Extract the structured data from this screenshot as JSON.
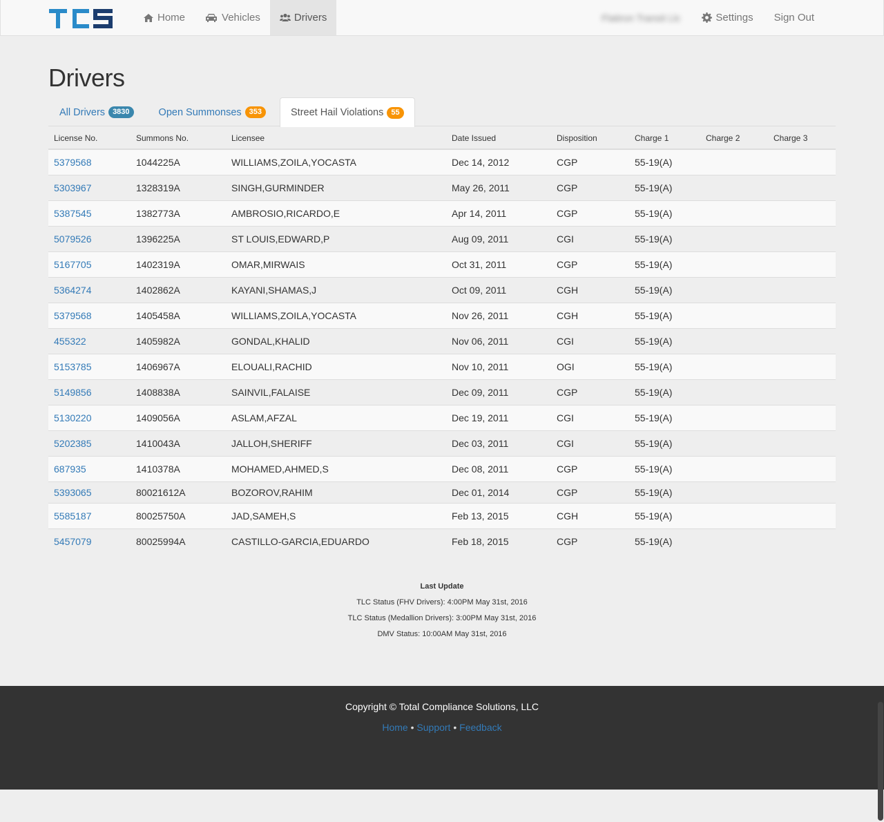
{
  "brand": {
    "logo_text": "TCS",
    "colors": {
      "logo_light": "#2a8bc9",
      "logo_dark": "#1c3d6e"
    }
  },
  "nav": {
    "home": "Home",
    "vehicles": "Vehicles",
    "drivers": "Drivers",
    "company": "Flatiron Transit Llc",
    "settings": "Settings",
    "sign_out": "Sign Out"
  },
  "page": {
    "title": "Drivers"
  },
  "tabs": [
    {
      "label": "All Drivers",
      "badge": "3830",
      "active": false
    },
    {
      "label": "Open Summonses",
      "badge": "353",
      "active": false
    },
    {
      "label": "Street Hail Violations",
      "badge": "55",
      "active": true
    }
  ],
  "table": {
    "headers": [
      "License No.",
      "Summons No.",
      "Licensee",
      "Date Issued",
      "Disposition",
      "Charge 1",
      "Charge 2",
      "Charge 3"
    ],
    "rows": [
      [
        "5379568",
        "1044225A",
        "WILLIAMS,ZOILA,YOCASTA",
        "Dec 14, 2012",
        "CGP",
        "55-19(A)",
        "",
        ""
      ],
      [
        "5303967",
        "1328319A",
        "SINGH,GURMINDER",
        "May 26, 2011",
        "CGP",
        "55-19(A)",
        "",
        ""
      ],
      [
        "5387545",
        "1382773A",
        "AMBROSIO,RICARDO,E",
        "Apr 14, 2011",
        "CGP",
        "55-19(A)",
        "",
        ""
      ],
      [
        "5079526",
        "1396225A",
        "ST LOUIS,EDWARD,P",
        "Aug 09, 2011",
        "CGI",
        "55-19(A)",
        "",
        ""
      ],
      [
        "5167705",
        "1402319A",
        "OMAR,MIRWAIS",
        "Oct 31, 2011",
        "CGP",
        "55-19(A)",
        "",
        ""
      ],
      [
        "5364274",
        "1402862A",
        "KAYANI,SHAMAS,J",
        "Oct 09, 2011",
        "CGH",
        "55-19(A)",
        "",
        ""
      ],
      [
        "5379568",
        "1405458A",
        "WILLIAMS,ZOILA,YOCASTA",
        "Nov 26, 2011",
        "CGH",
        "55-19(A)",
        "",
        ""
      ],
      [
        "455322",
        "1405982A",
        "GONDAL,KHALID",
        "Nov 06, 2011",
        "CGI",
        "55-19(A)",
        "",
        ""
      ],
      [
        "5153785",
        "1406967A",
        "ELOUALI,RACHID",
        "Nov 10, 2011",
        "OGI",
        "55-19(A)",
        "",
        ""
      ],
      [
        "5149856",
        "1408838A",
        "SAINVIL,FALAISE",
        "Dec 09, 2011",
        "CGP",
        "55-19(A)",
        "",
        ""
      ],
      [
        "5130220",
        "1409056A",
        "ASLAM,AFZAL",
        "Dec 19, 2011",
        "CGI",
        "55-19(A)",
        "",
        ""
      ],
      [
        "5202385",
        "1410043A",
        "JALLOH,SHERIFF",
        "Dec 03, 2011",
        "CGI",
        "55-19(A)",
        "",
        ""
      ],
      [
        "687935",
        "1410378A",
        "MOHAMED,AHMED,S",
        "Dec 08, 2011",
        "CGP",
        "55-19(A)",
        "",
        ""
      ],
      [
        "5393065",
        "80021612A",
        "BOZOROV,RAHIM",
        "Dec 01, 2014",
        "CGP",
        "55-19(A)",
        "",
        ""
      ],
      [
        "5585187",
        "80025750A",
        "JAD,SAMEH,S",
        "Feb 13, 2015",
        "CGH",
        "55-19(A)",
        "",
        ""
      ],
      [
        "5457079",
        "80025994A",
        "CASTILLO-GARCIA,EDUARDO",
        "Feb 18, 2015",
        "CGP",
        "55-19(A)",
        "",
        ""
      ]
    ]
  },
  "status": {
    "title": "Last Update",
    "lines": [
      "TLC Status (FHV Drivers): 4:00PM May 31st, 2016",
      "TLC Status (Medallion Drivers): 3:00PM May 31st, 2016",
      "DMV Status: 10:00AM May 31st, 2016"
    ]
  },
  "footer": {
    "copyright": "Copyright © Total Compliance Solutions, LLC",
    "links": [
      "Home",
      "Support",
      "Feedback"
    ],
    "separator": "•"
  }
}
